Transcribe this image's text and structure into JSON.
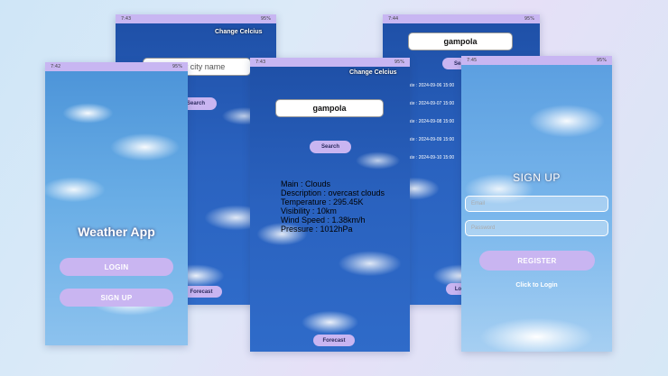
{
  "login_screen": {
    "status_time": "7:42",
    "status_battery": "95%",
    "title": "Weather App",
    "login_label": "LOGIN",
    "signup_label": "SIGN UP"
  },
  "search_screen": {
    "status_time": "7:43",
    "status_battery": "95%",
    "change_units": "Change Celcius",
    "city_placeholder": "Enter city name",
    "search_label": "Search",
    "forecast_label": "Forecast"
  },
  "results_screen": {
    "status_time": "7:43",
    "status_battery": "95%",
    "change_units": "Change Celcius",
    "city_value": "gampola",
    "search_label": "Search",
    "info_lines": [
      "Main : Clouds",
      "Description : overcast clouds",
      "Temperature : 295.45K",
      "Visibility : 10km",
      "Wind Speed : 1.38km/h",
      "Pressure : 1012hPa"
    ],
    "forecast_label": "Forecast"
  },
  "forecast_screen": {
    "status_time": "7:44",
    "status_battery": "95%",
    "city_value": "gampola",
    "search_label": "Search",
    "dates": [
      "Date : 2024-09-06 15:00",
      "Date : 2024-09-07 15:00",
      "Date : 2024-09-08 15:00",
      "Date : 2024-09-09 15:00",
      "Date : 2024-09-10 15:00"
    ],
    "logout_label": "Logout"
  },
  "signup_screen": {
    "status_time": "7:45",
    "status_battery": "95%",
    "title": "SIGN UP",
    "email_placeholder": "Email",
    "password_placeholder": "Password",
    "register_label": "REGISTER",
    "login_link": "Click to Login"
  }
}
